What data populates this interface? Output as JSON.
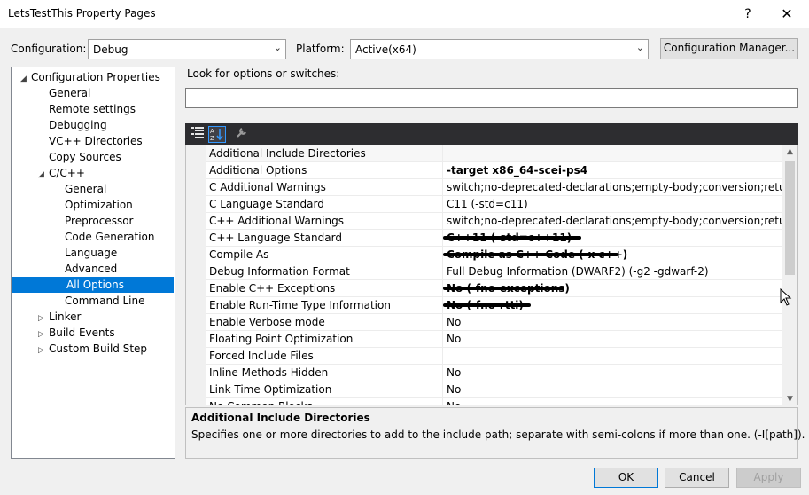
{
  "window": {
    "title": "LetsTestThis Property Pages",
    "help_glyph": "?",
    "close_glyph": "✕"
  },
  "top": {
    "configuration_label": "Configuration:",
    "configuration_value": "Debug",
    "platform_label": "Platform:",
    "platform_value": "Active(x64)",
    "config_manager_label": "Configuration Manager..."
  },
  "tree": {
    "items": [
      {
        "label": "Configuration Properties",
        "level": 0,
        "expander": "◢"
      },
      {
        "label": "General",
        "level": 1
      },
      {
        "label": "Remote settings",
        "level": 1
      },
      {
        "label": "Debugging",
        "level": 1
      },
      {
        "label": "VC++ Directories",
        "level": 1
      },
      {
        "label": "Copy Sources",
        "level": 1
      },
      {
        "label": "C/C++",
        "level": 1,
        "expander": "◢"
      },
      {
        "label": "General",
        "level": 2
      },
      {
        "label": "Optimization",
        "level": 2
      },
      {
        "label": "Preprocessor",
        "level": 2
      },
      {
        "label": "Code Generation",
        "level": 2
      },
      {
        "label": "Language",
        "level": 2
      },
      {
        "label": "Advanced",
        "level": 2
      },
      {
        "label": "All Options",
        "level": 2,
        "selected": true
      },
      {
        "label": "Command Line",
        "level": 2
      },
      {
        "label": "Linker",
        "level": 1,
        "expander": "▷"
      },
      {
        "label": "Build Events",
        "level": 1,
        "expander": "▷"
      },
      {
        "label": "Custom Build Step",
        "level": 1,
        "expander": "▷"
      }
    ]
  },
  "search": {
    "label": "Look for options or switches:",
    "value": ""
  },
  "grid": {
    "rows": [
      {
        "name": "Additional Include Directories",
        "value": ""
      },
      {
        "name": "Additional Options",
        "value": "-target x86_64-scei-ps4",
        "bold": true
      },
      {
        "name": "C Additional Warnings",
        "value": "switch;no-deprecated-declarations;empty-body;conversion;return-type;p"
      },
      {
        "name": "C Language Standard",
        "value": "C11 (-std=c11)"
      },
      {
        "name": "C++ Additional Warnings",
        "value": "switch;no-deprecated-declarations;empty-body;conversion;return-type;p"
      },
      {
        "name": "C++ Language Standard",
        "value": "C++11 (-std=c++11)",
        "bold": true,
        "scratched": true,
        "scratch_width": 0.41
      },
      {
        "name": "Compile As",
        "value": "Compile as C++ Code (-x c++)",
        "bold": true,
        "scratched": true,
        "scratch_width": 0.52
      },
      {
        "name": "Debug Information Format",
        "value": "Full Debug Information (DWARF2) (-g2 -gdwarf-2)"
      },
      {
        "name": "Enable C++ Exceptions",
        "value": "No (-fno-exceptions)",
        "bold": true,
        "scratched": true,
        "scratch_width": 0.36
      },
      {
        "name": "Enable Run-Time Type Information",
        "value": "No (-fno-rtti)",
        "bold": true,
        "scratched": true,
        "scratch_width": 0.26
      },
      {
        "name": "Enable Verbose mode",
        "value": "No"
      },
      {
        "name": "Floating Point Optimization",
        "value": "No"
      },
      {
        "name": "Forced Include Files",
        "value": ""
      },
      {
        "name": "Inline Methods Hidden",
        "value": "No"
      },
      {
        "name": "Link Time Optimization",
        "value": "No"
      },
      {
        "name": "No Common Blocks",
        "value": "No"
      }
    ]
  },
  "description": {
    "title": "Additional Include Directories",
    "text": "Specifies one or more directories to add to the include path; separate with semi-colons if more than one. (-I[path])."
  },
  "buttons": {
    "ok": "OK",
    "cancel": "Cancel",
    "apply": "Apply"
  },
  "icons": {
    "toolbar_categorized": "categorized-list-icon",
    "toolbar_alphabetical": "alphabetical-sort-icon",
    "toolbar_property_pages": "wrench-icon"
  }
}
